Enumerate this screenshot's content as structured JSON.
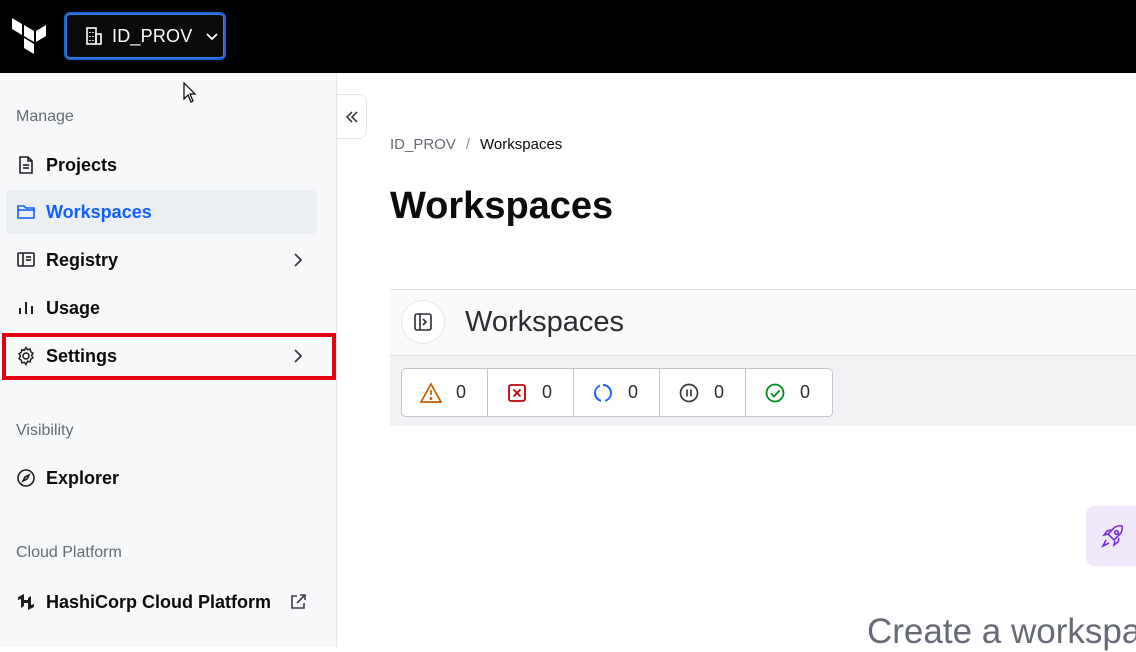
{
  "topbar": {
    "org_name": "ID_PROV"
  },
  "sidebar": {
    "sections": [
      {
        "title": "Manage"
      },
      {
        "title": "Visibility"
      },
      {
        "title": "Cloud Platform"
      }
    ],
    "items": [
      {
        "label": "Projects",
        "icon": "file-text-icon"
      },
      {
        "label": "Workspaces",
        "icon": "folder-icon",
        "active": true
      },
      {
        "label": "Registry",
        "icon": "registry-icon"
      },
      {
        "label": "Usage",
        "icon": "bar-chart-icon"
      },
      {
        "label": "Settings",
        "icon": "gear-icon"
      },
      {
        "label": "Explorer",
        "icon": "compass-icon"
      },
      {
        "label": "HashiCorp Cloud Platform",
        "icon": "hashicorp-icon"
      }
    ]
  },
  "breadcrumb": {
    "org": "ID_PROV",
    "separator": "/",
    "current": "Workspaces"
  },
  "main": {
    "title": "Workspaces",
    "panel_title": "Workspaces",
    "status_counts": [
      {
        "name": "warning",
        "count": "0"
      },
      {
        "name": "errored",
        "count": "0"
      },
      {
        "name": "running",
        "count": "0"
      },
      {
        "name": "paused",
        "count": "0"
      },
      {
        "name": "applied",
        "count": "0"
      }
    ],
    "create_text": "Create a workspace"
  },
  "colors": {
    "accent": "#1060ff",
    "highlight": "#e3000f",
    "warning": "#c75e00",
    "error": "#c00005",
    "running": "#1060ff",
    "success": "#008a22"
  }
}
